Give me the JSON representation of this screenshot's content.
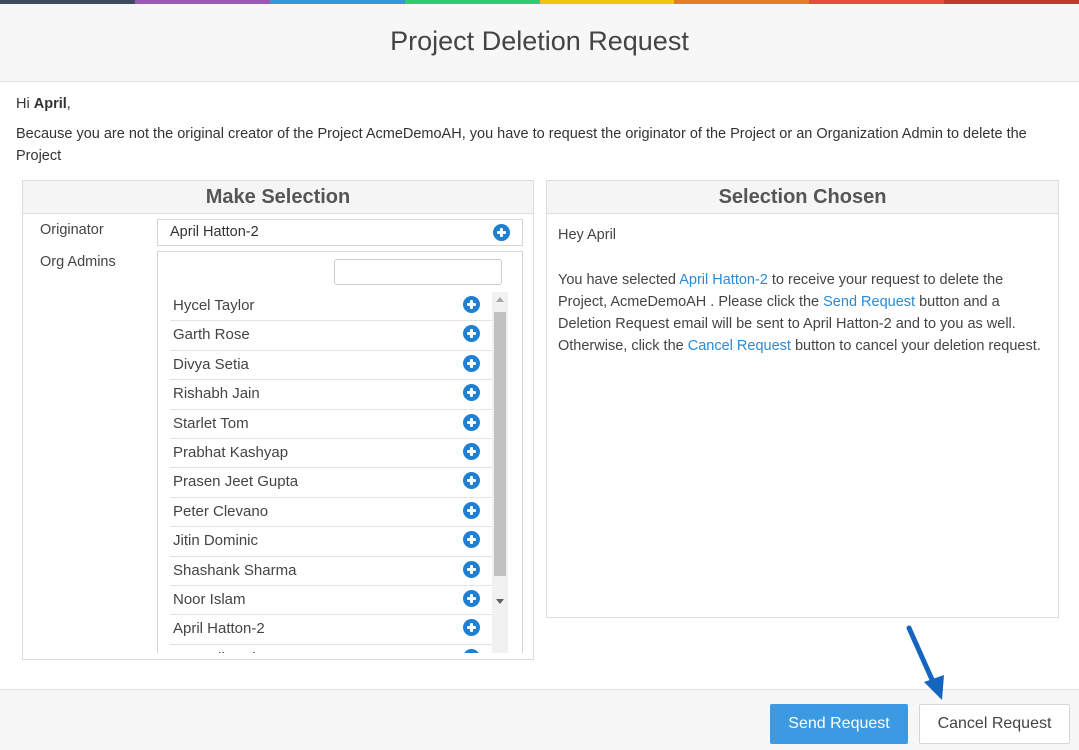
{
  "top_bar_colors": [
    "#3e4a5e",
    "#9b59b6",
    "#3498db",
    "#2ecc71",
    "#f1c40f",
    "#e67e22",
    "#e74c3c",
    "#c0392b"
  ],
  "dialog": {
    "title": "Project Deletion Request",
    "greeting_prefix": "Hi ",
    "greeting_name": "April",
    "greeting_suffix": ",",
    "explanation": "Because you are not the original creator of the Project AcmeDemoAH, you have to request the originator of the Project or an Organization Admin to delete the Project"
  },
  "make_selection": {
    "title": "Make Selection",
    "originator_label": "Originator",
    "originator_value": "April Hatton-2",
    "org_admins_label": "Org Admins",
    "search_value": "",
    "admins": [
      "Hycel Taylor",
      "Garth Rose",
      "Divya Setia",
      "Rishabh Jain",
      "Starlet Tom",
      "Prabhat Kashyap",
      "Prasen Jeet Gupta",
      "Peter Clevano",
      "Jitin Dominic",
      "Shashank Sharma",
      "Noor Islam",
      "April Hatton-2",
      "Anuradha Bh..."
    ]
  },
  "selection_chosen": {
    "title": "Selection Chosen",
    "salutation": "Hey April",
    "p1": "You have selected ",
    "selected_name": "April Hatton-2",
    "p2": " to receive your request to delete the Project, AcmeDemoAH . Please click the ",
    "send_link": "Send Request",
    "p3": " button and a Deletion Request email will be sent to April Hatton-2 and to you as well. Otherwise, click the ",
    "cancel_link": "Cancel Request",
    "p4": " button to cancel your deletion request."
  },
  "footer": {
    "send_label": "Send Request",
    "cancel_label": "Cancel Request"
  },
  "colors": {
    "accent": "#3b9ae1",
    "link": "#2a8ad4",
    "icon_blue": "#1f7fd1",
    "annotation_arrow": "#1565c0"
  }
}
